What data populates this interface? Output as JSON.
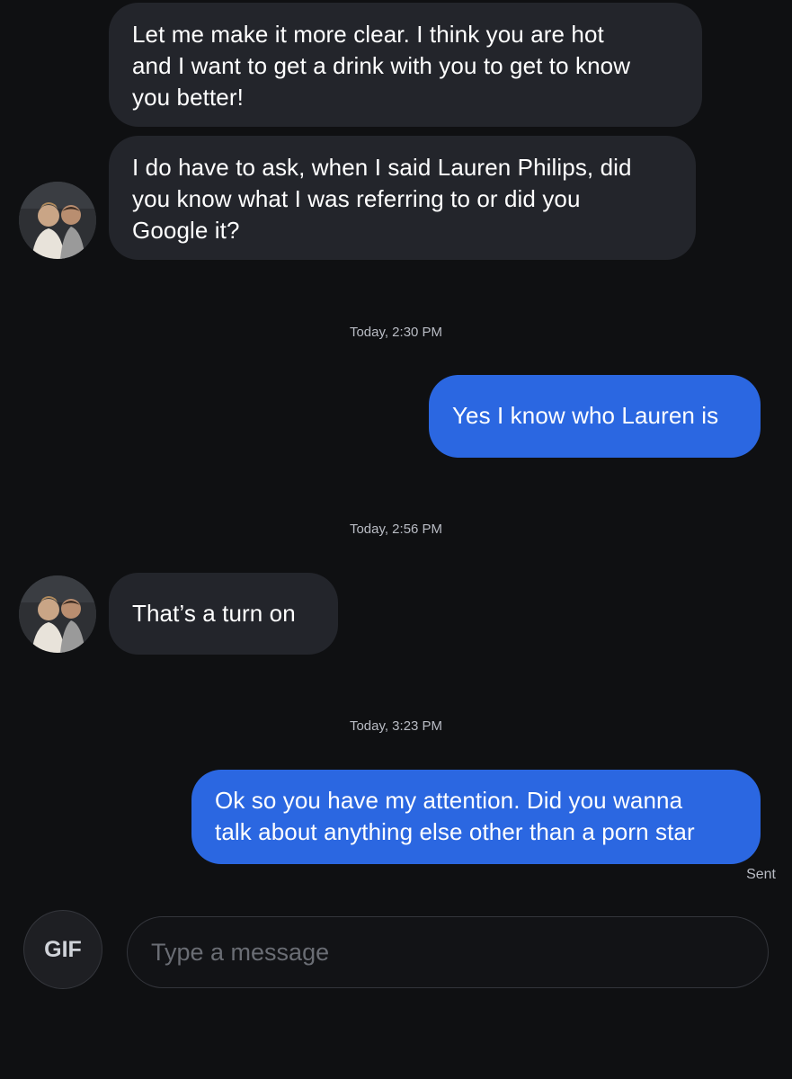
{
  "messages": [
    {
      "direction": "incoming",
      "lines": [
        "Let me make it more clear. I think you are hot",
        "and I want to get a drink with you to get to know",
        "you better!"
      ]
    },
    {
      "direction": "incoming",
      "lines": [
        "I do have to ask, when I said Lauren Philips, did",
        "you know what I was referring to or did you",
        "Google it?"
      ]
    },
    {
      "direction": "outgoing",
      "lines": [
        "Yes I know who Lauren is"
      ]
    },
    {
      "direction": "incoming",
      "lines": [
        "That’s a turn on"
      ]
    },
    {
      "direction": "outgoing",
      "lines": [
        "Ok so you have my attention. Did you wanna",
        "talk about anything else other than a porn star"
      ]
    }
  ],
  "timestamps": [
    "Today, 2:30 PM",
    "Today, 2:56 PM",
    "Today, 3:23 PM"
  ],
  "status": "Sent",
  "composer": {
    "gif_label": "GIF",
    "placeholder": "Type a message"
  },
  "colors": {
    "background": "#0f1012",
    "incoming_bubble": "#23252b",
    "outgoing_bubble": "#2b67e1"
  },
  "icons": {
    "avatar": "match-profile-photo"
  }
}
